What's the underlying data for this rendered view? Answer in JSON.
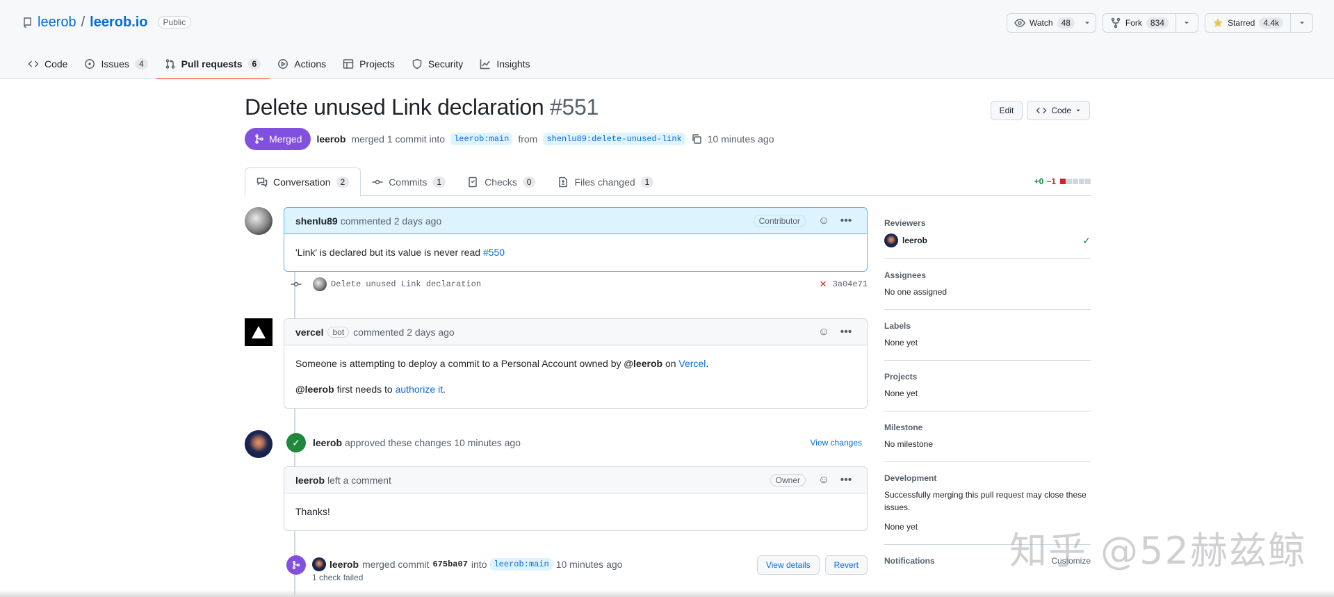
{
  "repo": {
    "owner": "leerob",
    "separator": "/",
    "name": "leerob.io",
    "visibility": "Public",
    "watch": {
      "label": "Watch",
      "count": "48"
    },
    "fork": {
      "label": "Fork",
      "count": "834"
    },
    "star": {
      "label": "Starred",
      "count": "4.4k"
    }
  },
  "nav": {
    "code": "Code",
    "issues": {
      "label": "Issues",
      "count": "4"
    },
    "pulls": {
      "label": "Pull requests",
      "count": "6"
    },
    "actions": "Actions",
    "projects": "Projects",
    "security": "Security",
    "insights": "Insights"
  },
  "pr": {
    "title": "Delete unused Link declaration",
    "number": "#551",
    "edit_label": "Edit",
    "code_label": "Code",
    "state": "Merged",
    "merged_by": "leerob",
    "merged_text": "merged 1 commit into",
    "base_branch": "leerob:main",
    "from_text": "from",
    "head_branch": "shenlu89:delete-unused-link",
    "time": "10 minutes ago"
  },
  "tabs": {
    "conversation": {
      "label": "Conversation",
      "count": "2"
    },
    "commits": {
      "label": "Commits",
      "count": "1"
    },
    "checks": {
      "label": "Checks",
      "count": "0"
    },
    "files": {
      "label": "Files changed",
      "count": "1"
    },
    "diff_add": "+0",
    "diff_del": "−1"
  },
  "timeline": {
    "first_comment": {
      "author": "shenlu89",
      "action": "commented 2 days ago",
      "role": "Contributor",
      "body": "'Link' is declared but its value is never read",
      "issue_link": "#550"
    },
    "commit": {
      "message": "Delete unused Link declaration",
      "sha": "3a04e71"
    },
    "vercel_comment": {
      "author": "vercel",
      "bot": "bot",
      "action": "commented 2 days ago",
      "body1_pre": "Someone is attempting to deploy a commit to a Personal Account owned by",
      "body1_mention": "@leerob",
      "body1_on": "on",
      "body1_link": "Vercel",
      "body1_end": ".",
      "body2_mention": "@leerob",
      "body2_text": "first needs to",
      "body2_link": "authorize it",
      "body2_end": "."
    },
    "review": {
      "author": "leerob",
      "action": "approved these changes 10 minutes ago",
      "view_changes": "View changes"
    },
    "review_comment": {
      "author": "leerob",
      "action": "left a comment",
      "role": "Owner",
      "body": "Thanks!"
    },
    "merged": {
      "author": "leerob",
      "text": "merged commit",
      "sha": "675ba07",
      "into": "into",
      "branch": "leerob:main",
      "time": "10 minutes ago",
      "checks": "1 check failed",
      "view_details": "View details",
      "revert": "Revert"
    }
  },
  "sidebar": {
    "reviewers": {
      "title": "Reviewers",
      "name": "leerob"
    },
    "assignees": {
      "title": "Assignees",
      "value": "No one assigned"
    },
    "labels": {
      "title": "Labels",
      "value": "None yet"
    },
    "projects": {
      "title": "Projects",
      "value": "None yet"
    },
    "milestone": {
      "title": "Milestone",
      "value": "No milestone"
    },
    "development": {
      "title": "Development",
      "desc": "Successfully merging this pull request may close these issues.",
      "value": "None yet"
    },
    "notifications": {
      "title": "Notifications",
      "customize": "Customize"
    }
  },
  "watermark": "知乎 @52赫兹鲸",
  "colors": {
    "merged": "#8250df",
    "approved": "#1f883d",
    "link": "#0969da",
    "accent_underline": "#fd8c73"
  }
}
